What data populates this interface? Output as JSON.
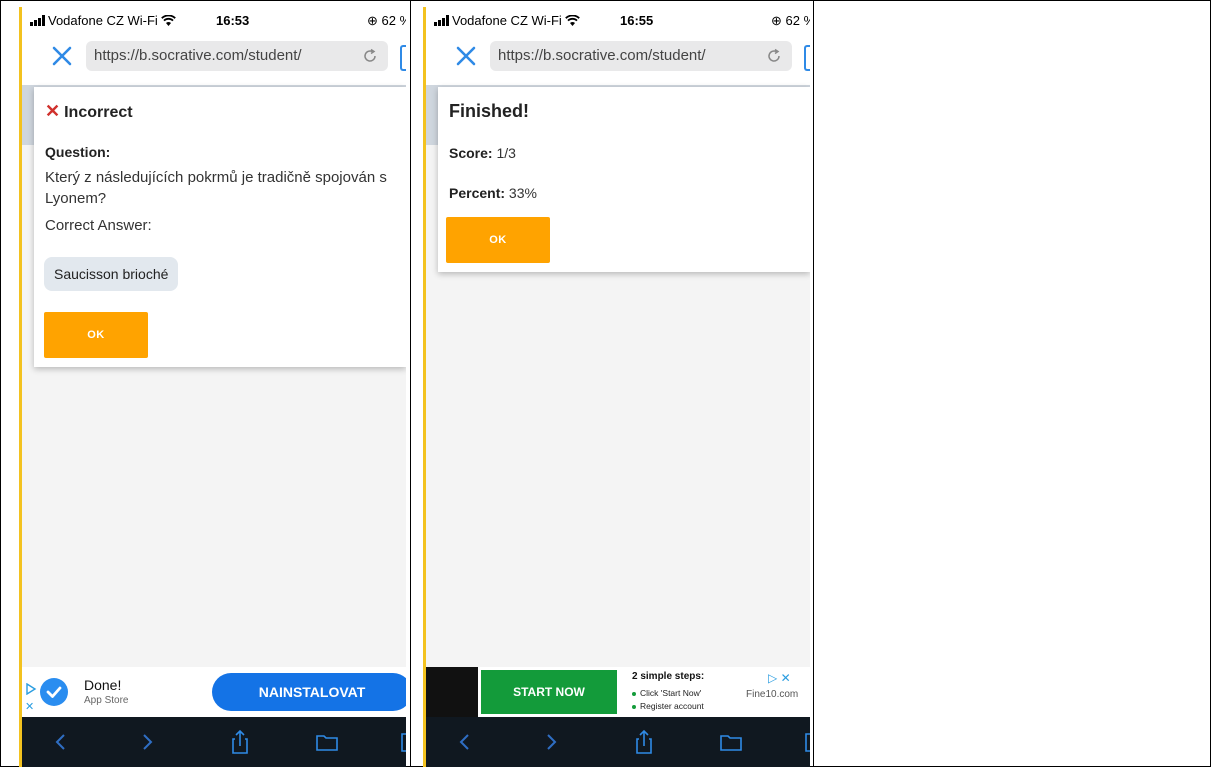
{
  "screens": [
    {
      "status": {
        "carrier": "Vodafone CZ Wi-Fi",
        "time": "16:53",
        "battery": "62 %"
      },
      "browser": {
        "url": "https://b.socrative.com/student/"
      },
      "card": {
        "title": "Incorrect",
        "question_label": "Question:",
        "question_text": "Který z následujících pokrmů je tradičně spojován s Lyonem?",
        "correct_label": "Correct Answer:",
        "answer": "Saucisson brioché",
        "ok_label": "OK"
      },
      "ad": {
        "title": "Done!",
        "subtitle": "App Store",
        "button": "NAINSTALOVAT"
      }
    },
    {
      "status": {
        "carrier": "Vodafone CZ Wi-Fi",
        "time": "16:55",
        "battery": "62 %"
      },
      "browser": {
        "url": "https://b.socrative.com/student/"
      },
      "card": {
        "title": "Finished!",
        "score_label": "Score:",
        "score_value": "1/3",
        "percent_label": "Percent:",
        "percent_value": "33%",
        "ok_label": "OK"
      },
      "ad": {
        "button": "START NOW",
        "heading": "2 simple steps:",
        "step1": "Click 'Start Now'",
        "step2": "Register account",
        "brand": "Fine10.com"
      }
    }
  ],
  "icons": {
    "close": "close-icon",
    "reload": "reload-icon",
    "back": "chevron-left-icon",
    "forward": "chevron-right-icon",
    "share": "share-icon",
    "bookmarks": "folder-icon",
    "tabs": "tabs-icon",
    "wifi": "wifi-icon",
    "ad_choices": "ad-choices-icon"
  },
  "colors": {
    "accent": "#ffa300",
    "link": "#2f8ae6",
    "error": "#d0312d",
    "frame": "#f3c21f"
  }
}
